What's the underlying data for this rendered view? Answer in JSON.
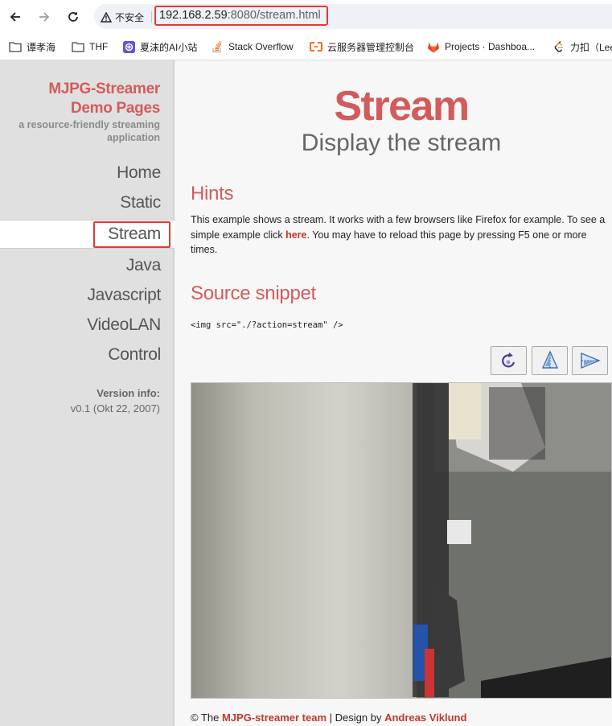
{
  "browser": {
    "security_label": "不安全",
    "url_host": "192.168.2.59",
    "url_rest": ":8080/stream.html",
    "bookmarks": [
      {
        "label": "谭孝海",
        "icon": "folder-icon"
      },
      {
        "label": "THF",
        "icon": "folder-icon"
      },
      {
        "label": "夏沫的AI小站",
        "icon": "openai-icon"
      },
      {
        "label": "Stack Overflow",
        "icon": "stackoverflow-icon"
      },
      {
        "label": "云服务器管理控制台",
        "icon": "aliyun-icon"
      },
      {
        "label": "Projects · Dashboa...",
        "icon": "gitlab-icon"
      },
      {
        "label": "力扣（Lee",
        "icon": "leetcode-icon"
      }
    ]
  },
  "sidebar": {
    "title_line1": "MJPG-Streamer",
    "title_line2": "Demo Pages",
    "subtitle_line1": "a resource-friendly streaming",
    "subtitle_line2": "application",
    "menu": [
      "Home",
      "Static",
      "Stream",
      "Java",
      "Javascript",
      "VideoLAN",
      "Control"
    ],
    "active": "Stream",
    "version_label": "Version info:",
    "version_value": "v0.1 (Okt 22, 2007)"
  },
  "main": {
    "title": "Stream",
    "subtitle": "Display the stream",
    "hints_heading": "Hints",
    "hints_text_1": "This example shows a stream. It works with a few browsers like Firefox for example. To see a simple example click ",
    "hints_link": "here",
    "hints_text_2": ". You may have to reload this page by pressing F5 one or more times.",
    "snippet_heading": "Source snippet",
    "snippet_code": "<img src=\"./?action=stream\" />",
    "buttons": [
      {
        "name": "rotate-button",
        "icon": "rotate-icon"
      },
      {
        "name": "flip-vertical-button",
        "icon": "flip-vertical-icon"
      },
      {
        "name": "flip-horizontal-button",
        "icon": "flip-horizontal-icon"
      }
    ]
  },
  "footer": {
    "prefix": "© The ",
    "team_link": "MJPG-streamer team",
    "middle": " | Design by ",
    "designer_link": "Andreas Viklund"
  }
}
